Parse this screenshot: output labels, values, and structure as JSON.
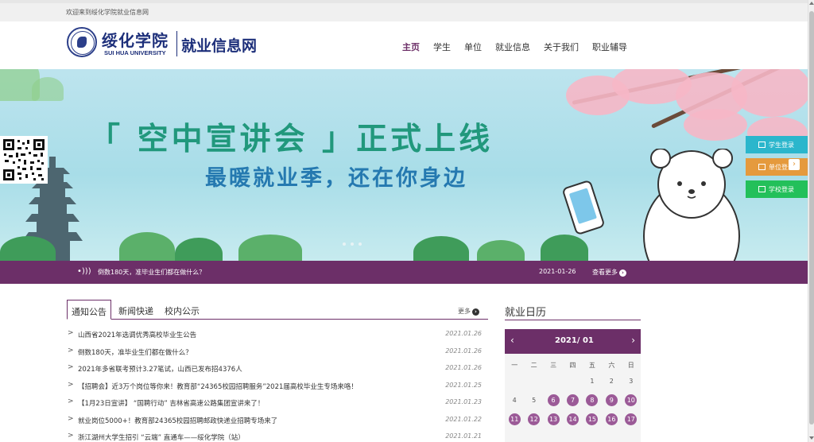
{
  "topbar": {
    "welcome": "欢迎来到绥化学院就业信息网"
  },
  "header": {
    "logo_cn": "绥化学院",
    "logo_en": "SUI HUA UNIVERSITY",
    "site_name": "就业信息网",
    "nav": [
      "主页",
      "学生",
      "单位",
      "就业信息",
      "关于我们",
      "职业辅导"
    ],
    "active_nav": "主页"
  },
  "banner": {
    "title": "「 空中宣讲会 」正式上线",
    "subtitle": "最暖就业季，还在你身边",
    "slides": 3
  },
  "side_buttons": {
    "student": "学生登录",
    "unit": "单位登录",
    "school": "学校登录"
  },
  "ticker": {
    "message": "倒数180天，准毕业生们都在做什么？",
    "date": "2021-01-26",
    "more": "查看更多"
  },
  "news": {
    "tabs": [
      "通知公告",
      "新闻快递",
      "校内公示"
    ],
    "active_tab": "通知公告",
    "more": "更多",
    "items": [
      {
        "title": "山西省2021年选调优秀高校毕业生公告",
        "date": "2021.01.26"
      },
      {
        "title": "倒数180天，准毕业生们都在做什么？",
        "date": "2021.01.26"
      },
      {
        "title": "2021年多省联考预计3.27笔试，山西已发布招4376人",
        "date": "2021.01.26"
      },
      {
        "title": "【招聘会】近3万个岗位等你来！教育部“24365校园招聘服务”2021届高校毕业生专场来咯！",
        "date": "2021.01.25"
      },
      {
        "title": "【1月23日宣讲】 “国聘行动” 吉林省高速公路集团宣讲来了！",
        "date": "2021.01.23"
      },
      {
        "title": "就业岗位5000+！教育部24365校园招聘邮政快递业招聘专场来了",
        "date": "2021.01.22"
      },
      {
        "title": "浙江湖州大学生招引 “云端” 直通车——绥化学院（站）",
        "date": "2021.01.21"
      }
    ]
  },
  "calendar": {
    "title": "就业日历",
    "month": "2021/ 01",
    "weekdays": [
      "一",
      "二",
      "三",
      "四",
      "五",
      "六",
      "日"
    ],
    "rows": [
      [
        {
          "d": ""
        },
        {
          "d": ""
        },
        {
          "d": ""
        },
        {
          "d": ""
        },
        {
          "d": "1"
        },
        {
          "d": "2"
        },
        {
          "d": "3"
        }
      ],
      [
        {
          "d": "4"
        },
        {
          "d": "5"
        },
        {
          "d": "6",
          "m": true
        },
        {
          "d": "7",
          "m": true
        },
        {
          "d": "8",
          "m": true
        },
        {
          "d": "9",
          "m": true
        },
        {
          "d": "10",
          "m": true
        }
      ],
      [
        {
          "d": "11",
          "m": true
        },
        {
          "d": "12",
          "m": true
        },
        {
          "d": "13",
          "m": true
        },
        {
          "d": "14",
          "m": true
        },
        {
          "d": "15",
          "m": true
        },
        {
          "d": "16",
          "m": true
        },
        {
          "d": "17",
          "m": true
        }
      ]
    ]
  },
  "colors": {
    "brand": "#6c2f68",
    "title_green": "#21987c",
    "subtitle_blue": "#2579b0"
  }
}
